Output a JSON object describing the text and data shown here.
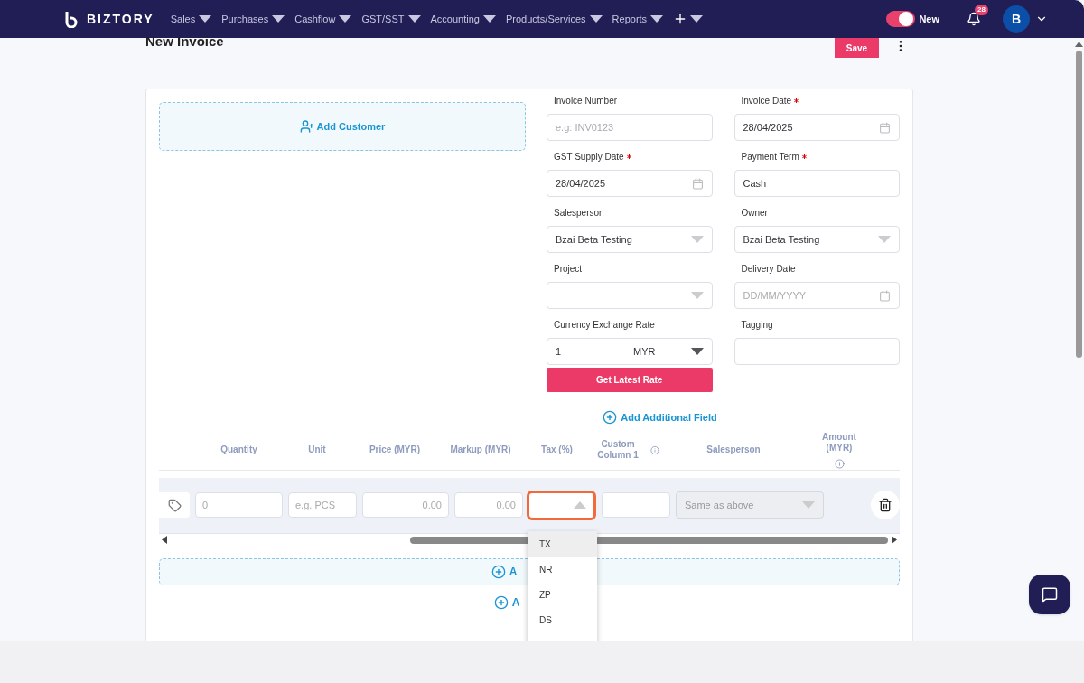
{
  "nav": {
    "logo": "BIZTORY",
    "menus": [
      {
        "label": "Sales"
      },
      {
        "label": "Purchases"
      },
      {
        "label": "Cashflow"
      },
      {
        "label": "GST/SST"
      },
      {
        "label": "Accounting"
      },
      {
        "label": "Products/Services"
      },
      {
        "label": "Reports"
      }
    ],
    "toggle": {
      "label": "New",
      "on": true
    },
    "notification_count": "28",
    "avatar": "B"
  },
  "page": {
    "title": "New Invoice",
    "save": "Save"
  },
  "add_customer": "Add Customer",
  "fields": [
    {
      "label": "Invoice Number",
      "required": false,
      "kind": "text",
      "placeholder": "e.g: INV0123"
    },
    {
      "label": "Invoice Date",
      "required": true,
      "kind": "date",
      "value": "28/04/2025"
    },
    {
      "label": "GST Supply Date",
      "required": true,
      "kind": "date",
      "value": "28/04/2025"
    },
    {
      "label": "Payment Term",
      "required": true,
      "kind": "text",
      "value": "Cash"
    },
    {
      "label": "Salesperson",
      "required": false,
      "kind": "select",
      "value": "Bzai Beta Testing"
    },
    {
      "label": "Owner",
      "required": false,
      "kind": "select",
      "value": "Bzai Beta Testing"
    },
    {
      "label": "Project",
      "required": false,
      "kind": "select"
    },
    {
      "label": "Delivery Date",
      "required": false,
      "kind": "date",
      "placeholder": "DD/MM/YYYY"
    },
    {
      "label": "Currency Exchange Rate",
      "required": false,
      "kind": "currency",
      "value": "1",
      "currency": "MYR"
    },
    {
      "label": "Tagging",
      "required": false,
      "kind": "text"
    }
  ],
  "get_latest_rate": "Get Latest Rate",
  "add_additional_field": "Add Additional Field",
  "columns": [
    {
      "label": "Quantity",
      "info": false
    },
    {
      "label": "Unit",
      "info": false
    },
    {
      "label": "Price (MYR)",
      "info": false
    },
    {
      "label": "Markup (MYR)",
      "info": false
    },
    {
      "label": "Tax (%)",
      "info": false
    },
    {
      "label": "Custom Column 1",
      "info": true
    },
    {
      "label": "Salesperson",
      "info": false
    },
    {
      "label": "Amount (MYR)",
      "info": true
    }
  ],
  "row": {
    "quantity": {
      "placeholder": "0"
    },
    "unit": {
      "placeholder": "e.g. PCS"
    },
    "price": {
      "placeholder": "0.00"
    },
    "markup": {
      "placeholder": "0.00"
    },
    "salesperson": {
      "placeholder": "Same as above"
    }
  },
  "tax_options": [
    {
      "label": "TX",
      "selected": true
    },
    {
      "label": "NR",
      "selected": false
    },
    {
      "label": "ZP",
      "selected": false
    },
    {
      "label": "DS",
      "selected": false
    }
  ],
  "add_buttons": [
    "A",
    "A"
  ]
}
